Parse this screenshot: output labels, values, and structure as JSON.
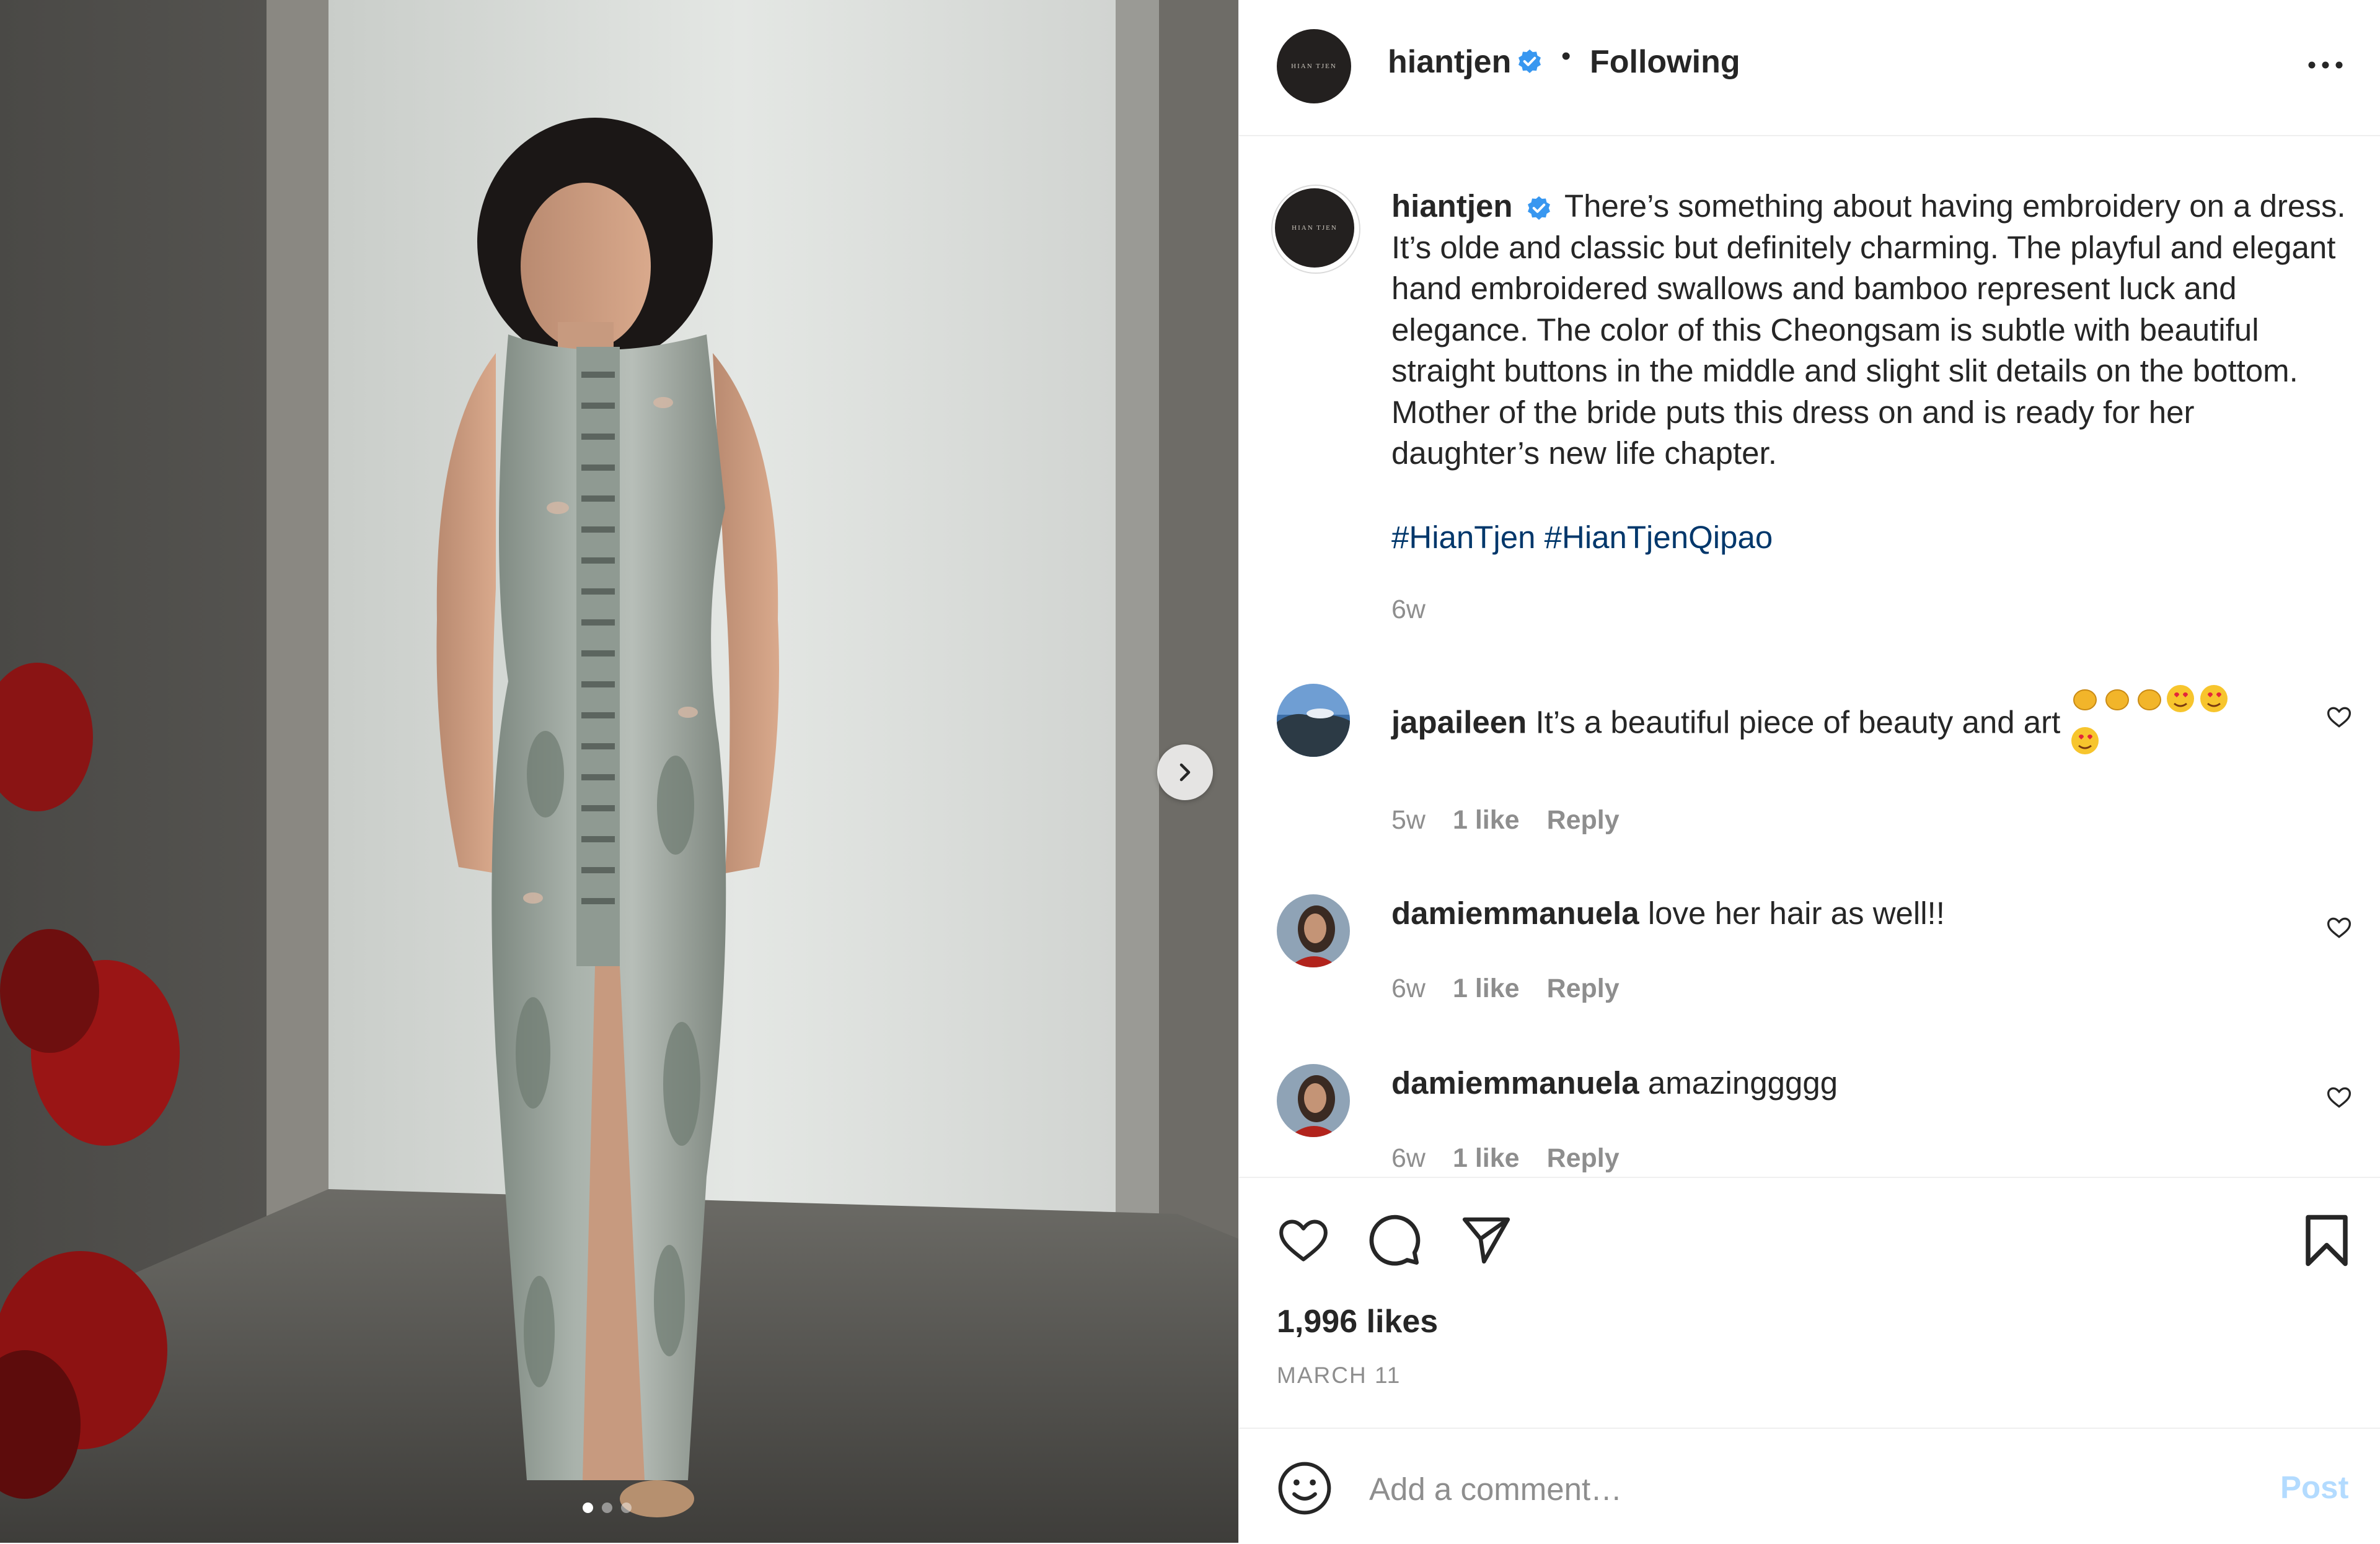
{
  "post": {
    "image_alt": "Woman in grey embroidered cheongsam",
    "carousel_dots": 3,
    "active_dot": 0
  },
  "header": {
    "avatar_text": "HIAN TJEN",
    "username": "hiantjen",
    "separator": "•",
    "follow_status": "Following"
  },
  "caption": {
    "username": "hiantjen",
    "text": "There’s something about having embroidery on a dress. It’s olde and classic but definitely charming. The playful and elegant hand embroidered swallows and bamboo represent luck and elegance. The color of this Cheongsam is subtle with beautiful straight buttons in the middle and slight slit details on the bottom. Mother of the bride puts this dress on and is ready for her daughter’s new life chapter.",
    "hashtag_1": "#HianTjen",
    "hashtag_2": "#HianTjenQipao",
    "time": "6w"
  },
  "comments": [
    {
      "username": "japaileen",
      "text": "It’s a beautiful piece of beauty and art",
      "time": "5w",
      "likes": "1 like",
      "reply": "Reply"
    },
    {
      "username": "damiemmanuela",
      "text": "love her hair as well!!",
      "time": "6w",
      "likes": "1 like",
      "reply": "Reply"
    },
    {
      "username": "damiemmanuela",
      "text": "amazinggggg",
      "time": "6w",
      "likes": "1 like",
      "reply": "Reply"
    }
  ],
  "actions": {
    "likes": "1,996 likes",
    "date": "MARCH 11"
  },
  "add_comment": {
    "placeholder": "Add a comment…",
    "post_label": "Post"
  },
  "colors": {
    "link": "#00376b",
    "verified": "#3897f0",
    "muted": "#8e8e8e",
    "post_disabled": "#b3dbff"
  }
}
